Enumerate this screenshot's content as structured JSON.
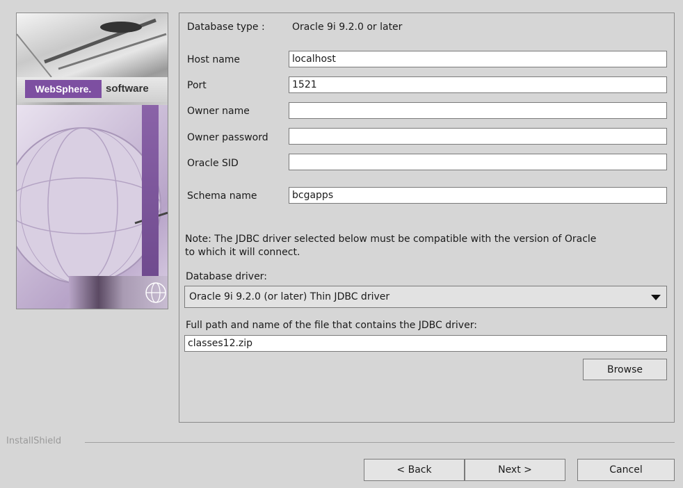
{
  "banner": {
    "brand_primary": "WebSphere.",
    "brand_secondary": "software"
  },
  "form": {
    "database_type_label": "Database type :",
    "database_type_value": "Oracle 9i 9.2.0 or later",
    "host_label": "Host name",
    "host_value": "localhost",
    "port_label": "Port",
    "port_value": "1521",
    "owner_label": "Owner name",
    "owner_value": "",
    "password_label": "Owner password",
    "password_value": "",
    "sid_label": "Oracle SID",
    "sid_value": "",
    "schema_label": "Schema name",
    "schema_value": "bcgapps",
    "note_line1": "Note: The JDBC driver selected below must be compatible with the version of  Oracle",
    "note_line2": "to which it will connect.",
    "driver_label": "Database driver:",
    "driver_selected": "Oracle 9i 9.2.0 (or later) Thin JDBC driver",
    "path_label": "Full path and name of the file that contains the JDBC driver:",
    "path_value": "classes12.zip",
    "browse_label": "Browse"
  },
  "footer": {
    "installer_brand": "InstallShield",
    "back_label": "< Back",
    "next_label": "Next >",
    "cancel_label": "Cancel"
  },
  "colors": {
    "window_bg": "#d6d6d6",
    "brand_purple": "#7d4fa1"
  }
}
